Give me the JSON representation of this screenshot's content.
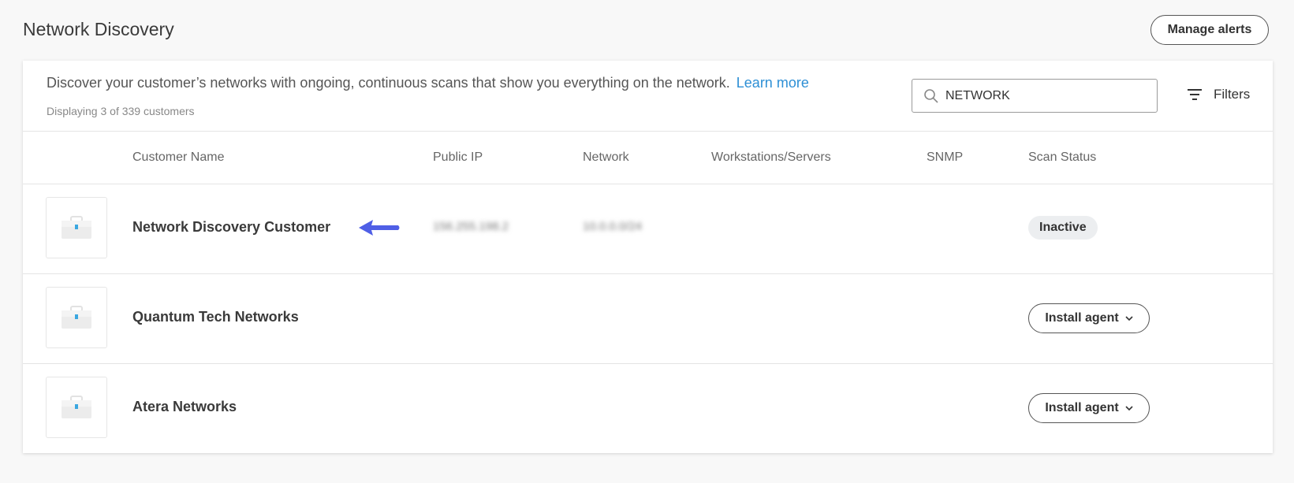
{
  "page": {
    "title": "Network Discovery",
    "manage_alerts_label": "Manage alerts"
  },
  "intro": {
    "text": "Discover your customer’s networks with ongoing, continuous scans that show you everything on the network.",
    "learn_more_label": "Learn more",
    "count_text": "Displaying 3 of 339 customers"
  },
  "search": {
    "value": "NETWORK",
    "icon": "search-icon"
  },
  "filters": {
    "label": "Filters",
    "icon": "filter-icon"
  },
  "table": {
    "columns": [
      "Customer Name",
      "Public IP",
      "Network",
      "Workstations/Servers",
      "SNMP",
      "Scan Status"
    ],
    "rows": [
      {
        "name": "Network Discovery Customer",
        "public_ip": "156.255.198.2",
        "network": "10.0.0.0/24",
        "status": "Inactive"
      },
      {
        "name": "Quantum Tech Networks",
        "status": "Install agent"
      },
      {
        "name": "Atera Networks",
        "status": "Install agent"
      }
    ]
  },
  "colors": {
    "link": "#2d8fd5",
    "arrow": "#4f5fe6",
    "badge_bg": "#eceef0"
  }
}
